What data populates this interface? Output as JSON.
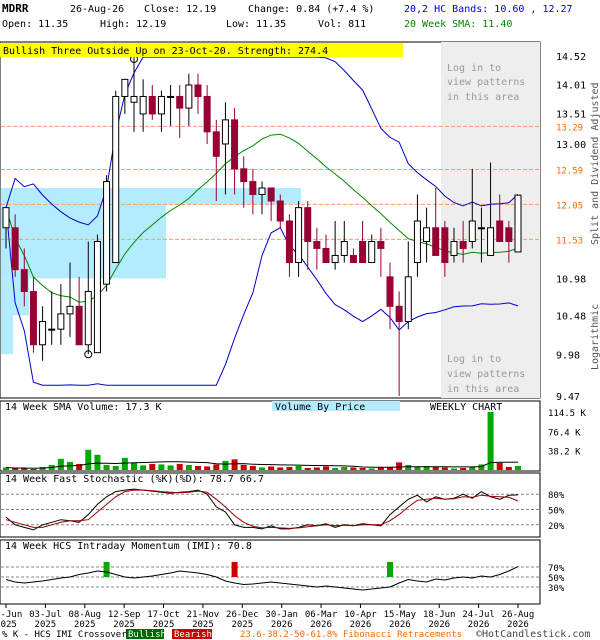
{
  "header": {
    "symbol": "MDRR",
    "date": "26-Aug-26",
    "close": "Close: 12.19",
    "change": "Change: 0.84 (+7.4 %)",
    "open": "Open: 11.35",
    "high": "High: 12.19",
    "low": "Low: 11.35",
    "vol": "Vol: 811",
    "bands": "20,2 HC Bands: 10.60 , 12.27",
    "sma20": "20 Week SMA: 11.40"
  },
  "pattern_banner": "Bullish Three Outside Up on 23-Oct-20. Strength: 274.4",
  "login_text_top": [
    "Log in to",
    "view patterns",
    "in this area"
  ],
  "login_text_bottom": [
    "Log in to",
    "view patterns",
    "in this area"
  ],
  "side_labels": {
    "adjusted": "Split and Dividend Adjusted",
    "log": "Logarithmic"
  },
  "price_axis": {
    "ticks": [
      "14.52",
      "14.01",
      "13.51",
      "13.29",
      "13.00",
      "12.59",
      "12.05",
      "11.53",
      "10.98",
      "10.48",
      "9.98",
      "9.47"
    ]
  },
  "volume_panel": {
    "title": "14 Week SMA Volume: 17.3 K",
    "vbp_label": "Volume By Price",
    "weekly_label": "WEEKLY CHART",
    "ticks": [
      "114.5 K",
      "76.4 K",
      "38.2 K"
    ]
  },
  "stoch_panel": {
    "title": "14 Week Fast Stochastic (%K)(%D): 78.7 66.7",
    "ticks": [
      "80%",
      "50%",
      "20%"
    ]
  },
  "imi_panel": {
    "title": "14 Week HCS Intraday Momentum (IMI): 70.8",
    "ticks": [
      "70%",
      "50%",
      "30%"
    ]
  },
  "x_axis": {
    "labels": [
      [
        "06-Jun",
        "2025"
      ],
      [
        "03-Jul",
        "2025"
      ],
      [
        "08-Aug",
        "2025"
      ],
      [
        "12-Sep",
        "2025"
      ],
      [
        "17-Oct",
        "2025"
      ],
      [
        "21-Nov",
        "2025"
      ],
      [
        "26-Dec",
        "2025"
      ],
      [
        "30-Jan",
        "2026"
      ],
      [
        "06-Mar",
        "2026"
      ],
      [
        "10-Apr",
        "2026"
      ],
      [
        "15-May",
        "2026"
      ],
      [
        "18-Jun",
        "2026"
      ],
      [
        "24-Jul",
        "2026"
      ],
      [
        "26-Aug",
        "2026"
      ]
    ]
  },
  "footer": {
    "crossover": "% K - HCS IMI Crossover:",
    "bullish": "Bullish",
    "bearish": "Bearish",
    "fib": "23.6-38.2-50-61.8% Fibonacci Retracements",
    "copyright": "©HotCandlestick.com"
  },
  "colors": {
    "bull": "#006600",
    "bear": "#990033",
    "green_bar": "#00aa00",
    "red_bar": "#cc0000",
    "band": "#0000cc",
    "sma": "#008800",
    "banner": "#ffff00",
    "vbp": "#b3ecff",
    "fib": "#ff9966"
  },
  "chart_data": [
    {
      "type": "candlestick",
      "title": "MDRR",
      "scale": "log",
      "ylim": [
        9.47,
        14.52
      ],
      "fib_levels": [
        13.29,
        12.59,
        12.05,
        11.53
      ],
      "series": [
        {
          "name": "Open",
          "values": [
            11.7,
            11.7,
            11.1,
            10.8,
            10.1,
            10.3,
            10.3,
            10.5,
            10.6,
            10.1,
            10.0,
            10.9,
            11.2,
            13.8,
            13.7,
            13.5,
            13.8,
            13.5,
            13.8,
            13.8,
            13.6,
            14.0,
            13.8,
            13.2,
            13.0,
            13.4,
            12.6,
            12.4,
            12.2,
            12.3,
            12.1,
            11.8,
            11.2,
            12.0,
            11.5,
            11.4,
            11.2,
            11.3,
            11.3,
            11.5,
            11.2,
            11.5,
            11.0,
            10.6,
            10.4,
            11.2,
            11.5,
            11.7,
            11.7,
            11.3,
            11.5,
            11.5,
            11.7,
            11.3,
            11.8,
            11.7,
            11.35
          ]
        },
        {
          "name": "High",
          "values": [
            12.0,
            11.9,
            11.4,
            11.0,
            10.6,
            10.8,
            10.9,
            11.2,
            11.0,
            11.5,
            11.6,
            12.5,
            13.9,
            14.1,
            14.5,
            14.1,
            14.0,
            13.9,
            14.0,
            14.0,
            14.2,
            14.2,
            14.0,
            13.4,
            13.7,
            13.6,
            12.8,
            12.6,
            12.4,
            12.3,
            12.2,
            11.9,
            12.1,
            12.1,
            11.7,
            11.6,
            11.8,
            11.8,
            11.4,
            11.8,
            11.6,
            11.7,
            11.2,
            10.8,
            11.5,
            12.2,
            12.0,
            12.3,
            11.8,
            11.7,
            11.8,
            12.6,
            12.0,
            12.7,
            12.2,
            11.8,
            12.19
          ]
        },
        {
          "name": "Low",
          "values": [
            11.4,
            11.0,
            10.6,
            10.0,
            9.9,
            10.1,
            10.1,
            10.2,
            10.2,
            9.98,
            10.0,
            10.8,
            11.2,
            13.5,
            13.2,
            13.2,
            13.4,
            13.2,
            13.3,
            13.1,
            13.3,
            13.5,
            13.0,
            12.1,
            12.2,
            12.2,
            12.0,
            11.9,
            11.9,
            11.8,
            11.7,
            11.0,
            11.0,
            11.1,
            11.1,
            11.2,
            11.1,
            11.2,
            11.2,
            11.2,
            11.2,
            11.0,
            10.3,
            9.47,
            10.3,
            11.0,
            11.2,
            11.3,
            11.0,
            11.2,
            11.2,
            11.4,
            11.2,
            11.3,
            11.5,
            11.2,
            11.35
          ]
        },
        {
          "name": "Close",
          "values": [
            12.0,
            11.1,
            10.8,
            10.1,
            10.4,
            10.3,
            10.5,
            10.6,
            10.1,
            10.8,
            11.5,
            12.4,
            13.8,
            14.1,
            13.8,
            13.8,
            13.5,
            13.8,
            13.8,
            13.6,
            14.0,
            13.8,
            13.2,
            12.8,
            13.4,
            12.6,
            12.4,
            12.2,
            12.3,
            12.1,
            11.8,
            11.2,
            12.0,
            11.5,
            11.4,
            11.2,
            11.3,
            11.5,
            11.2,
            11.2,
            11.5,
            11.4,
            10.6,
            10.4,
            11.0,
            11.8,
            11.7,
            11.3,
            11.2,
            11.5,
            11.4,
            11.8,
            11.7,
            11.7,
            11.5,
            11.5,
            12.19
          ]
        }
      ]
    },
    {
      "type": "bar",
      "title": "14 Week SMA Volume: 17.3 K",
      "ylim": [
        0,
        114.5
      ],
      "series": [
        {
          "name": "Volume",
          "values": [
            5,
            3,
            4,
            2,
            6,
            10,
            22,
            16,
            12,
            40,
            30,
            10,
            8,
            24,
            14,
            9,
            12,
            11,
            9,
            12,
            10,
            8,
            7,
            11,
            18,
            21,
            10,
            8,
            5,
            7,
            5,
            6,
            8,
            4,
            5,
            7,
            4,
            6,
            5,
            4,
            3,
            5,
            6,
            15,
            10,
            7,
            8,
            6,
            5,
            3,
            4,
            6,
            11,
            114.5,
            14,
            6,
            8
          ]
        }
      ]
    },
    {
      "type": "line",
      "title": "14 Week Fast Stochastic (%K)(%D): 78.7 66.7",
      "ylim": [
        0,
        100
      ],
      "series": [
        {
          "name": "%K",
          "values": [
            35,
            20,
            15,
            10,
            20,
            25,
            30,
            28,
            25,
            40,
            60,
            75,
            85,
            88,
            90,
            88,
            86,
            84,
            82,
            84,
            85,
            88,
            80,
            55,
            45,
            20,
            15,
            15,
            12,
            18,
            12,
            12,
            15,
            20,
            18,
            22,
            15,
            20,
            18,
            22,
            20,
            18,
            40,
            55,
            70,
            78,
            65,
            75,
            70,
            72,
            80,
            72,
            85,
            75,
            70,
            78,
            78.7
          ]
        },
        {
          "name": "%D",
          "values": [
            30,
            25,
            20,
            15,
            15,
            20,
            25,
            28,
            28,
            30,
            45,
            60,
            75,
            85,
            88,
            88,
            87,
            85,
            84,
            83,
            84,
            86,
            84,
            70,
            55,
            38,
            25,
            17,
            14,
            15,
            14,
            13,
            14,
            16,
            18,
            20,
            18,
            19,
            18,
            20,
            20,
            20,
            28,
            40,
            55,
            68,
            70,
            72,
            70,
            71,
            75,
            74,
            78,
            76,
            75,
            74,
            66.7
          ]
        }
      ]
    },
    {
      "type": "line",
      "title": "14 Week HCS Intraday Momentum (IMI): 70.8",
      "ylim": [
        0,
        100
      ],
      "series": [
        {
          "name": "IMI",
          "values": [
            45,
            40,
            38,
            40,
            42,
            45,
            48,
            50,
            55,
            58,
            62,
            60,
            55,
            50,
            48,
            50,
            52,
            55,
            58,
            62,
            60,
            58,
            55,
            50,
            42,
            38,
            35,
            36,
            38,
            40,
            38,
            36,
            34,
            32,
            30,
            32,
            30,
            28,
            26,
            24,
            26,
            28,
            30,
            38,
            45,
            42,
            40,
            46,
            44,
            48,
            50,
            48,
            52,
            50,
            55,
            62,
            70.8
          ]
        }
      ]
    }
  ]
}
